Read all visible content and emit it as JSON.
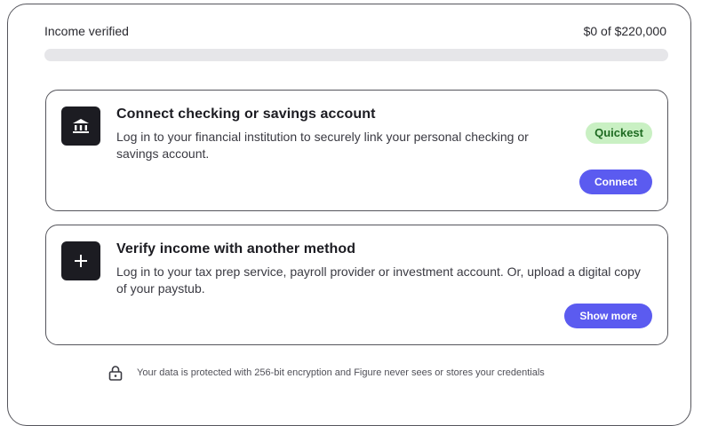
{
  "progress": {
    "label": "Income verified",
    "amount_text": "$0 of $220,000",
    "verified": 0,
    "total": 220000,
    "fill_color": "#5b5bf0"
  },
  "cards": [
    {
      "icon": "bank-icon",
      "title": "Connect checking or savings account",
      "description": "Log in to your financial institution to securely link your personal checking or savings account.",
      "badge": "Quickest",
      "button": "Connect"
    },
    {
      "icon": "plus-icon",
      "title": "Verify income with another method",
      "description": "Log in to your tax prep service, payroll provider or investment account. Or, upload a digital copy of your paystub.",
      "button": "Show more"
    }
  ],
  "footer": {
    "icon": "lock-icon",
    "text": "Your data is protected with 256-bit encryption and Figure never sees or stores your credentials"
  },
  "colors": {
    "accent": "#5b5bf0",
    "badge_bg": "#c9f0c3",
    "badge_text": "#1f6b22",
    "icon_tile": "#1c1c22"
  }
}
